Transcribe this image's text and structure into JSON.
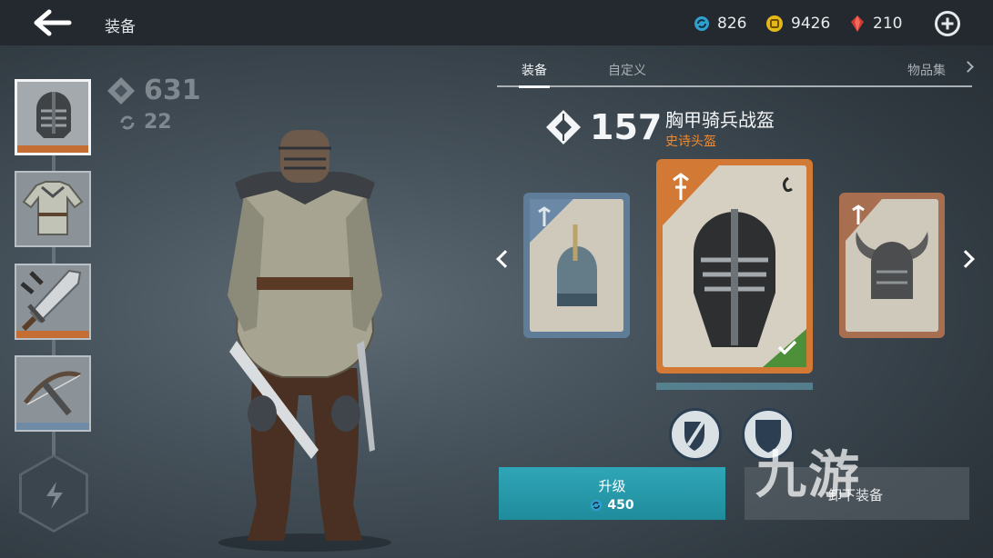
{
  "header": {
    "title": "装备",
    "currencies": [
      {
        "icon": "orb-currency-icon",
        "value": "826",
        "color": "#2f9fd0"
      },
      {
        "icon": "gold-coin-icon",
        "value": "9426",
        "color": "#e5b81a"
      },
      {
        "icon": "ruby-gem-icon",
        "value": "210",
        "color": "#d23a34"
      }
    ]
  },
  "stats": {
    "power": "631",
    "level": "22"
  },
  "slots": [
    {
      "name": "helmet",
      "bar_color": "#c46e34"
    },
    {
      "name": "armor",
      "bar_color": ""
    },
    {
      "name": "weapon",
      "bar_color": "#c46e34"
    },
    {
      "name": "ranged",
      "bar_color": "#6f8aa6"
    }
  ],
  "tabs": [
    "装备",
    "自定义",
    "物品集"
  ],
  "item": {
    "power": "157",
    "name": "胸甲骑兵战盔",
    "type": "史诗头盔"
  },
  "buttons": {
    "upgrade_label": "升级",
    "upgrade_cost": "450",
    "unequip_label": "卸下装备"
  },
  "watermark": "九游",
  "colors": {
    "epic": "#f08a2c",
    "accent": "#1f98aa",
    "equipped": "#4e8f3a"
  }
}
